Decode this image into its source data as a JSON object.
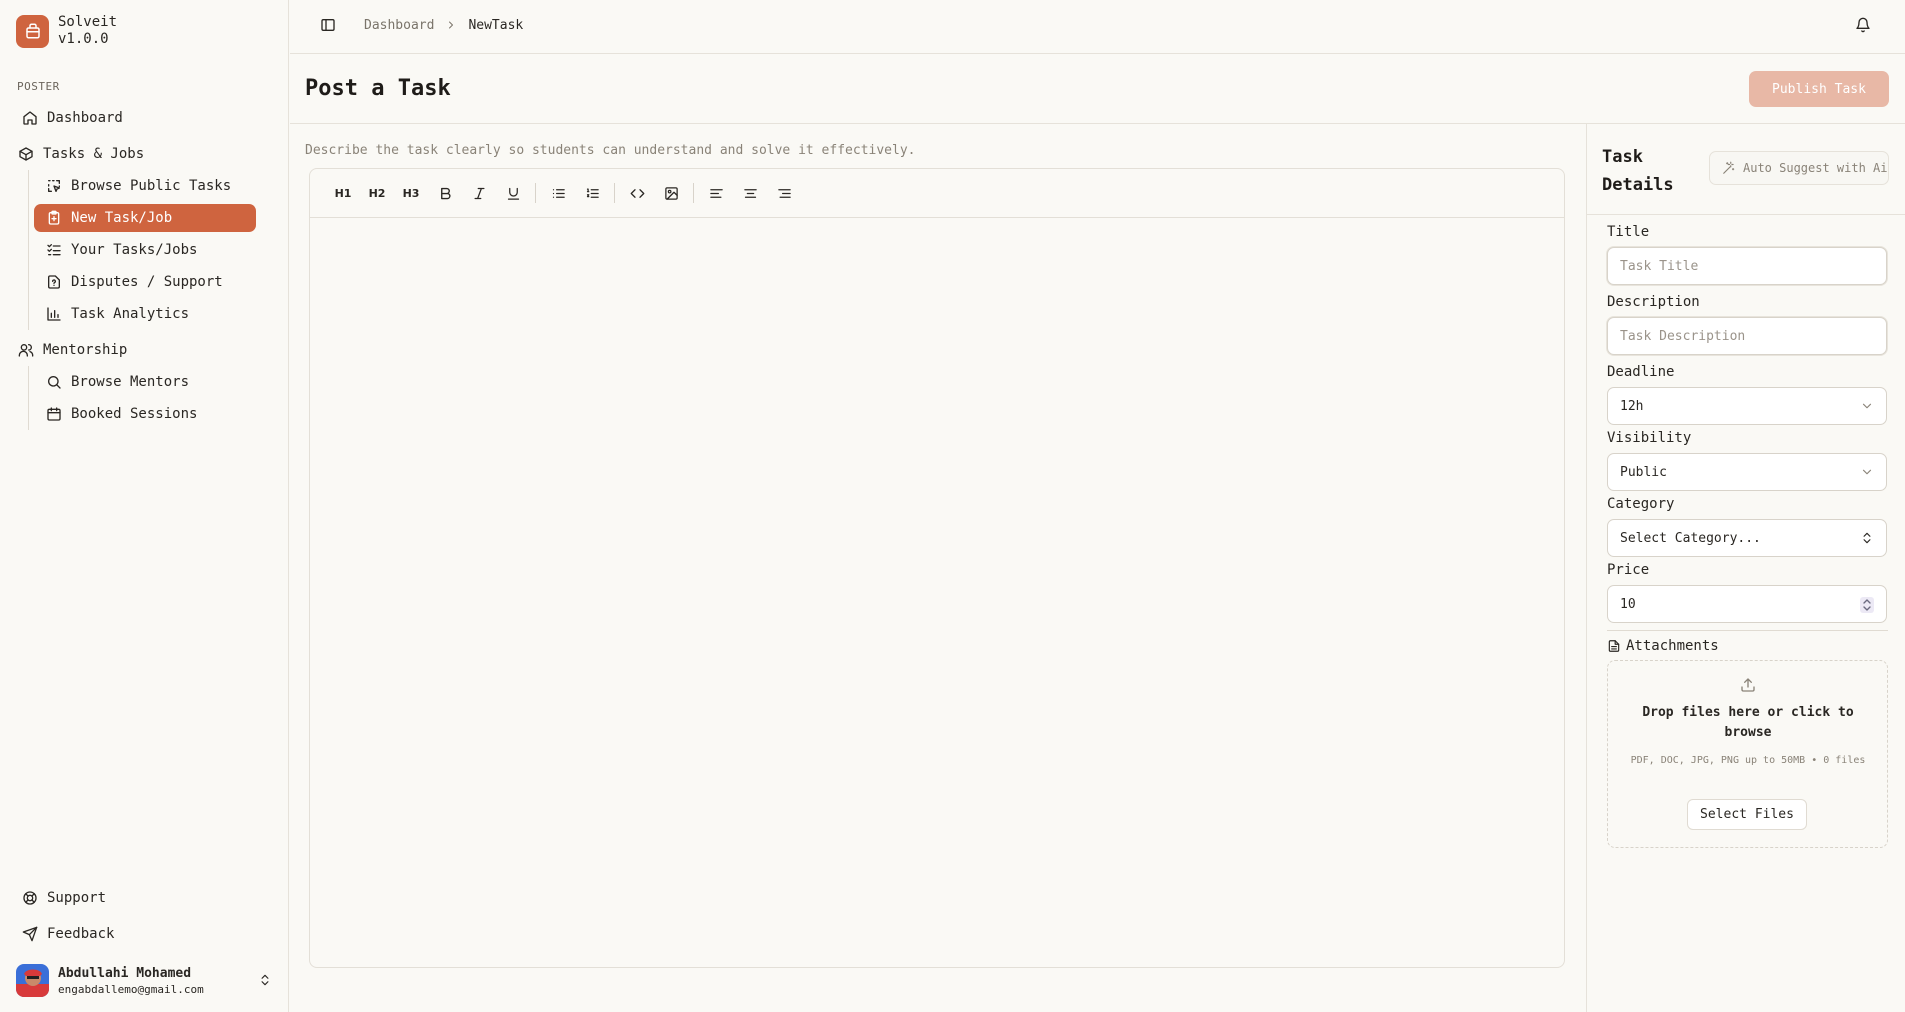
{
  "app": {
    "name": "Solveit",
    "version": "v1.0.0"
  },
  "sidebar": {
    "section_label": "POSTER",
    "items": [
      {
        "label": "Dashboard",
        "icon": "home-icon"
      },
      {
        "label": "Tasks & Jobs",
        "icon": "box-icon"
      },
      {
        "label": "Browse Public Tasks",
        "icon": "dashed-cursor-icon"
      },
      {
        "label": "New Task/Job",
        "icon": "clipboard-plus-icon",
        "active": true
      },
      {
        "label": "Your Tasks/Jobs",
        "icon": "list-check-icon"
      },
      {
        "label": "Disputes / Support",
        "icon": "file-question-icon"
      },
      {
        "label": "Task Analytics",
        "icon": "bar-chart-icon"
      },
      {
        "label": "Mentorship",
        "icon": "users-icon"
      },
      {
        "label": "Browse Mentors",
        "icon": "search-icon"
      },
      {
        "label": "Booked Sessions",
        "icon": "calendar-icon"
      }
    ],
    "footer": [
      {
        "label": "Support",
        "icon": "lifebuoy-icon"
      },
      {
        "label": "Feedback",
        "icon": "send-icon"
      }
    ],
    "user": {
      "name": "Abdullahi Mohamed",
      "email": "engabdallemo@gmail.com"
    }
  },
  "header": {
    "breadcrumb": [
      "Dashboard",
      "NewTask"
    ]
  },
  "page": {
    "title": "Post a Task",
    "publish_label": "Publish Task",
    "hint": "Describe the task clearly so students can understand and solve it effectively."
  },
  "toolbar": {
    "h1": "H1",
    "h2": "H2",
    "h3": "H3"
  },
  "details": {
    "title": "Task Details",
    "ai_label": "Auto Suggest with Ai",
    "title_label": "Title",
    "title_placeholder": "Task Title",
    "description_label": "Description",
    "description_placeholder": "Task Description",
    "deadline_label": "Deadline",
    "deadline_value": "12h",
    "visibility_label": "Visibility",
    "visibility_value": "Public",
    "category_label": "Category",
    "category_value": "Select Category...",
    "price_label": "Price",
    "price_value": "10",
    "attachments_label": "Attachments",
    "drop_text": "Drop files here or click to browse",
    "drop_sub": "PDF, DOC, JPG, PNG up to 50MB • 0 files",
    "select_files_label": "Select Files"
  },
  "colors": {
    "accent": "#cf643f",
    "accent_muted": "#e8b8a6",
    "background": "#faf9f5"
  }
}
